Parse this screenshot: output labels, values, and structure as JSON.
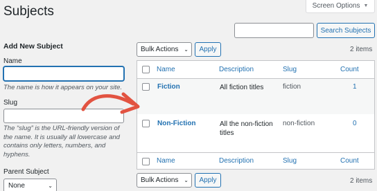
{
  "page": {
    "title": "Subjects"
  },
  "screen_options": {
    "label": "Screen Options",
    "icon": "caret-down-icon"
  },
  "search": {
    "placeholder": "",
    "button_label": "Search Subjects"
  },
  "form": {
    "heading": "Add New Subject",
    "name_label": "Name",
    "name_value": "",
    "name_help": "The name is how it appears on your site.",
    "slug_label": "Slug",
    "slug_value": "",
    "slug_help": "The “slug” is the URL-friendly version of the name. It is usually all lowercase and contains only letters, numbers, and hyphens.",
    "parent_label": "Parent Subject",
    "parent_value": "None"
  },
  "top_nav": {
    "bulk_label": "Bulk Actions",
    "apply_label": "Apply",
    "items_count": "2 items"
  },
  "bottom_nav": {
    "bulk_label": "Bulk Actions",
    "apply_label": "Apply",
    "items_count": "2 items"
  },
  "table": {
    "columns": [
      "Name",
      "Description",
      "Slug",
      "Count"
    ],
    "rows": [
      {
        "name": "Fiction",
        "description": "All fiction titles",
        "slug": "fiction",
        "count": "1"
      },
      {
        "name": "Non-Fiction",
        "description": "All the non-fiction titles",
        "slug": "non-fiction",
        "count": "0"
      }
    ]
  },
  "colors": {
    "accent": "#2271b1",
    "annotation_arrow": "#e25341"
  }
}
